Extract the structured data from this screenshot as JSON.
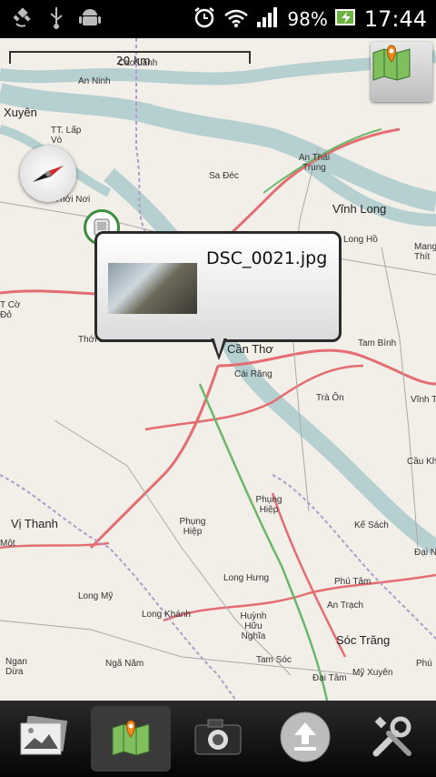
{
  "status_bar": {
    "battery_percent": "98%",
    "time": "17:44",
    "icons": [
      "gps-icon",
      "usb-icon",
      "android-debug-icon",
      "alarm-icon",
      "wifi-icon",
      "signal-icon",
      "battery-charging-icon"
    ]
  },
  "map": {
    "scale_label": "20 km",
    "places": [
      {
        "name": "Cao Lãnh"
      },
      {
        "name": "An Ninh"
      },
      {
        "name": "Xuyên"
      },
      {
        "name": "TT. Lấp Vò"
      },
      {
        "name": "Sa Đéc"
      },
      {
        "name": "An Thái Trung"
      },
      {
        "name": "Thới Nơi"
      },
      {
        "name": "Vĩnh Long"
      },
      {
        "name": "Long Hồ"
      },
      {
        "name": "Mang Thít"
      },
      {
        "name": "T Cờ Đỏ"
      },
      {
        "name": "Thới Lai"
      },
      {
        "name": "Cần Thơ"
      },
      {
        "name": "Cái Răng"
      },
      {
        "name": "Tam Bình"
      },
      {
        "name": "Trà Ôn"
      },
      {
        "name": "Vĩnh Th"
      },
      {
        "name": "Cầu Khi"
      },
      {
        "name": "Phụng Hiệp"
      },
      {
        "name": "Kế Sách"
      },
      {
        "name": "Vị Thanh"
      },
      {
        "name": "Một"
      },
      {
        "name": "Phụng Hiệp"
      },
      {
        "name": "Đại Ng"
      },
      {
        "name": "Phú Tâm"
      },
      {
        "name": "Long Mỹ"
      },
      {
        "name": "Long Hưng"
      },
      {
        "name": "An Trạch"
      },
      {
        "name": "Long Khánh"
      },
      {
        "name": "Huỳnh Hữu Nghĩa"
      },
      {
        "name": "Sóc Trăng"
      },
      {
        "name": "Ngan Dừa"
      },
      {
        "name": "Ngã Năm"
      },
      {
        "name": "Tam Sóc"
      },
      {
        "name": "Phú"
      },
      {
        "name": "Đại Tâm"
      },
      {
        "name": "Mỹ Xuyên"
      }
    ]
  },
  "popup": {
    "title": "DSC_0021.jpg"
  },
  "toolbar": {
    "buttons": [
      {
        "name": "gallery-button",
        "icon": "photos-icon"
      },
      {
        "name": "map-button",
        "icon": "map-icon",
        "active": true
      },
      {
        "name": "camera-button",
        "icon": "camera-icon"
      },
      {
        "name": "upload-button",
        "icon": "upload-icon"
      },
      {
        "name": "settings-button",
        "icon": "tools-icon"
      }
    ]
  },
  "colors": {
    "river": "#b6d0d1",
    "main_road": "#e46d71",
    "minor_road": "#a9a9a9",
    "boundary": "#b09bc8",
    "rail_green": "#6ab86a",
    "land": "#f2efe9"
  }
}
